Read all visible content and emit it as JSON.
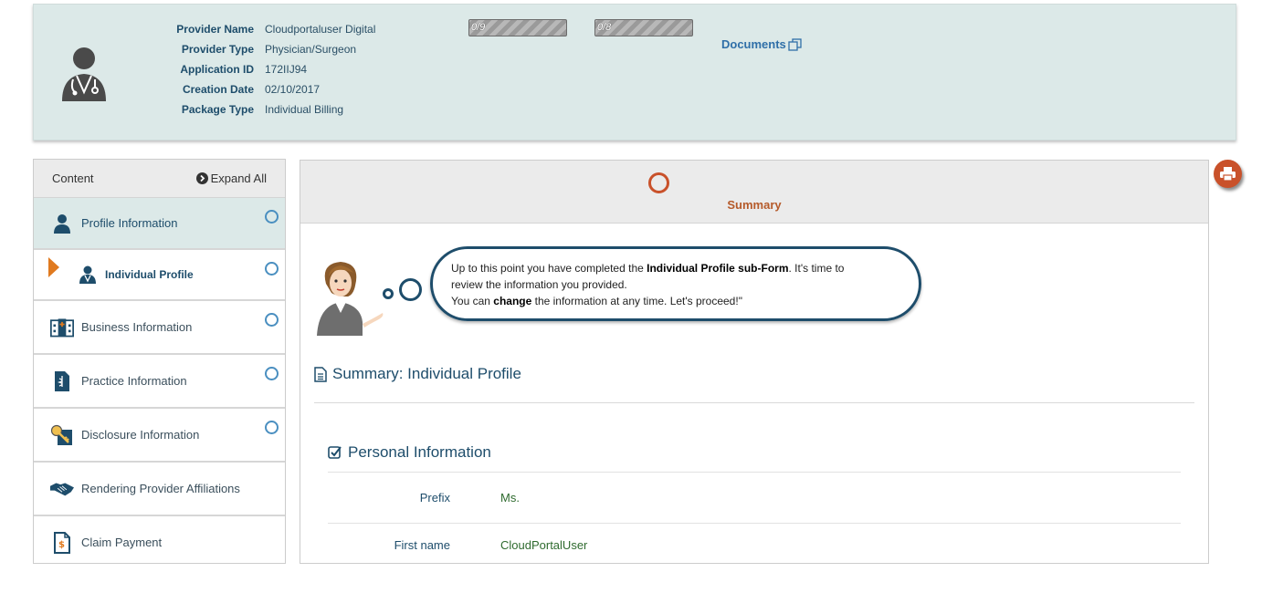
{
  "provider": {
    "fields": [
      {
        "label": "Provider Name",
        "value": "Cloudportaluser Digital"
      },
      {
        "label": "Provider Type",
        "value": "Physician/Surgeon"
      },
      {
        "label": "Application ID",
        "value": "172IIJ94"
      },
      {
        "label": "Creation Date",
        "value": "02/10/2017"
      },
      {
        "label": "Package Type",
        "value": "Individual Billing"
      }
    ],
    "progress": [
      {
        "text": "0/9",
        "fraction": 0
      },
      {
        "text": "0/8",
        "fraction": 0
      }
    ],
    "documents_label": "Documents"
  },
  "sidebar": {
    "header": "Content",
    "expand_label": "Expand All",
    "items": [
      {
        "label": "Profile Information",
        "icon": "user-icon"
      },
      {
        "label": "Individual Profile",
        "icon": "doctor-icon"
      },
      {
        "label": "Business Information",
        "icon": "building-icon"
      },
      {
        "label": "Practice Information",
        "icon": "medical-doc-icon"
      },
      {
        "label": "Disclosure Information",
        "icon": "key-icon"
      },
      {
        "label": "Rendering Provider Affiliations",
        "icon": "handshake-icon"
      },
      {
        "label": "Claim Payment",
        "icon": "dollar-doc-icon"
      }
    ]
  },
  "main": {
    "step_label": "Summary",
    "bubble": {
      "p1": "Up to this point you have completed the ",
      "p1_bold": "Individual Profile sub-Form",
      "p1_end": ". It's time to",
      "p2": "review the information you provided.",
      "p3": "You can ",
      "p3_bold": "change",
      "p3_end": " the information at any time. Let's proceed!\""
    },
    "summary_title": "Summary: Individual Profile",
    "section_title": "Personal Information",
    "fields": [
      {
        "label": "Prefix",
        "value": "Ms."
      },
      {
        "label": "First name",
        "value": "CloudPortalUser"
      }
    ]
  },
  "colors": {
    "accent": "#c9512a",
    "primary_text": "#1e4d6b",
    "header_bg": "#dce9e8",
    "value_green": "#2f6b2f"
  }
}
